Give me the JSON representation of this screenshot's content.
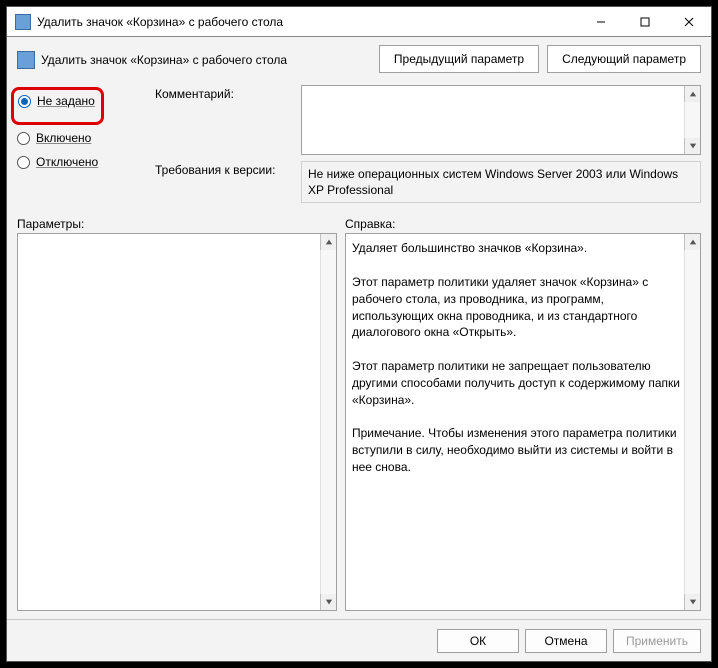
{
  "titlebar": {
    "title": "Удалить значок «Корзина» с рабочего стола"
  },
  "header": {
    "title": "Удалить значок «Корзина» с рабочего стола",
    "prev_btn": "Предыдущий параметр",
    "next_btn": "Следующий параметр"
  },
  "radios": {
    "not_configured": "Не задано",
    "enabled": "Включено",
    "disabled": "Отключено"
  },
  "fields": {
    "comment_label": "Комментарий:",
    "requirements_label": "Требования к версии:",
    "requirements_value": "Не ниже операционных систем Windows Server 2003 или Windows XP Professional",
    "params_label": "Параметры:",
    "help_label": "Справка:"
  },
  "help_text": "Удаляет большинство значков «Корзина».\n\nЭтот параметр политики удаляет значок «Корзина» с рабочего стола, из проводника, из программ, использующих окна проводника, и из стандартного диалогового окна «Открыть».\n\nЭтот параметр политики не запрещает пользователю другими способами получить доступ к содержимому папки «Корзина».\n\nПримечание. Чтобы изменения этого параметра политики вступили в силу, необходимо выйти из системы и войти в нее снова.",
  "footer": {
    "ok": "ОК",
    "cancel": "Отмена",
    "apply": "Применить"
  }
}
